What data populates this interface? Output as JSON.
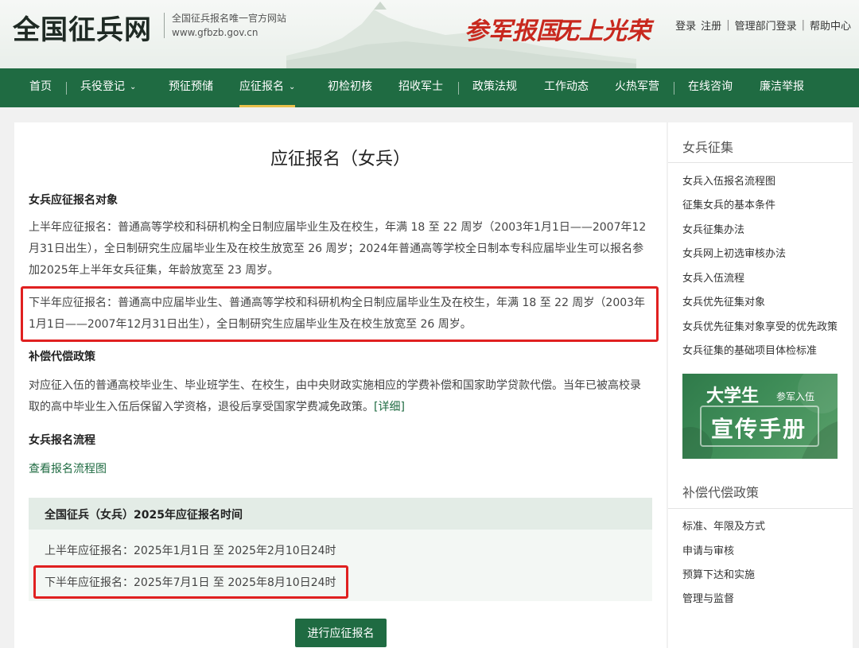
{
  "header": {
    "logo": "全国征兵网",
    "subtitle": "全国征兵报名唯一官方网站",
    "domain": "www.gfbzb.gov.cn",
    "slogan_1": "参军报国",
    "slogan_2": "无上光荣",
    "links": {
      "login": "登录",
      "register": "注册",
      "admin_login": "管理部门登录",
      "help": "帮助中心"
    }
  },
  "nav": {
    "items": [
      "首页",
      "兵役登记",
      "预征预储",
      "应征报名",
      "初检初核",
      "招收军士",
      "政策法规",
      "工作动态",
      "火热军营",
      "在线咨询",
      "廉洁举报"
    ],
    "active": "应征报名"
  },
  "main": {
    "title": "应征报名（女兵）",
    "section1_heading": "女兵应征报名对象",
    "first_half_text": "上半年应征报名：普通高等学校和科研机构全日制应届毕业生及在校生，年满 18 至 22 周岁（2003年1月1日——2007年12月31日出生），全日制研究生应届毕业生及在校生放宽至 26 周岁；2024年普通高等学校全日制本专科应届毕业生可以报名参加2025年上半年女兵征集，年龄放宽至 23 周岁。",
    "second_half_text": "下半年应征报名：普通高中应届毕业生、普通高等学校和科研机构全日制应届毕业生及在校生，年满 18 至 22 周岁（2003年1月1日——2007年12月31日出生），全日制研究生应届毕业生及在校生放宽至 26 周岁。",
    "section2_heading": "补偿代偿政策",
    "policy_text": "对应征入伍的普通高校毕业生、毕业班学生、在校生，由中央财政实施相应的学费补偿和国家助学贷款代偿。当年已被高校录取的高中毕业生入伍后保留入学资格，退役后享受国家学费减免政策。",
    "detail_link": "[详细]",
    "section3_heading": "女兵报名流程",
    "flow_link": "查看报名流程图",
    "schedule": {
      "title": "全国征兵（女兵）2025年应征报名时间",
      "first_half": "上半年应征报名：2025年1月1日 至 2025年2月10日24时",
      "second_half": "下半年应征报名：2025年7月1日 至 2025年8月10日24时"
    },
    "apply_button": "进行应征报名"
  },
  "sidebar": {
    "section1_title": "女兵征集",
    "section1_links": [
      "女兵入伍报名流程图",
      "征集女兵的基本条件",
      "女兵征集办法",
      "女兵网上初选审核办法",
      "女兵入伍流程",
      "女兵优先征集对象",
      "女兵优先征集对象享受的优先政策",
      "女兵征集的基础项目体检标准"
    ],
    "banner": {
      "line1": "大学生",
      "line1_small": "参军入伍",
      "line2": "宣传手册"
    },
    "section2_title": "补偿代偿政策",
    "section2_links": [
      "标准、年限及方式",
      "申请与审核",
      "预算下达和实施",
      "管理与监督"
    ]
  },
  "colors": {
    "nav_green": "#1f6b42",
    "slogan_red": "#c8281e",
    "highlight_red": "#e02020",
    "active_underline": "#e8c04a"
  }
}
